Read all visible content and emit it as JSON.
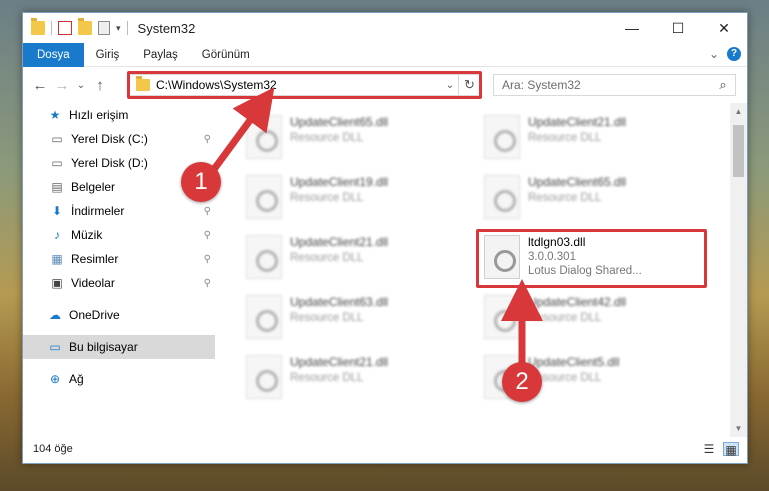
{
  "window": {
    "title": "System32",
    "minimize": "—",
    "maximize": "☐",
    "close": "✕"
  },
  "ribbon": {
    "tabs": [
      "Dosya",
      "Giriş",
      "Paylaş",
      "Görünüm"
    ],
    "help": "?",
    "expand": "⌄"
  },
  "nav": {
    "back": "←",
    "forward": "→",
    "recent": "⌄",
    "up": "↑"
  },
  "address": {
    "path": "C:\\Windows\\System32",
    "dropdown": "⌄",
    "refresh": "↻"
  },
  "search": {
    "placeholder": "Ara: System32",
    "icon": "⌕"
  },
  "sidebar": {
    "items": [
      {
        "label": "Hızlı erişim",
        "icon": "★",
        "pinned": false
      },
      {
        "label": "Yerel Disk (C:)",
        "icon": "▭",
        "pinned": true
      },
      {
        "label": "Yerel Disk (D:)",
        "icon": "▭",
        "pinned": false
      },
      {
        "label": "Belgeler",
        "icon": "▤",
        "pinned": true
      },
      {
        "label": "İndirmeler",
        "icon": "⬇",
        "pinned": true
      },
      {
        "label": "Müzik",
        "icon": "♪",
        "pinned": true
      },
      {
        "label": "Resimler",
        "icon": "▦",
        "pinned": true
      },
      {
        "label": "Videolar",
        "icon": "▣",
        "pinned": true
      },
      {
        "label": "OneDrive",
        "icon": "☁",
        "pinned": false
      },
      {
        "label": "Bu bilgisayar",
        "icon": "▭",
        "pinned": false
      },
      {
        "label": "Ağ",
        "icon": "⊕",
        "pinned": false
      }
    ],
    "pin_icon": "⚲"
  },
  "files": [
    {
      "name": "UpdateClient65.dll",
      "desc": "Resource DLL"
    },
    {
      "name": "UpdateClient21.dll",
      "desc": "Resource DLL"
    },
    {
      "name": "UpdateClient19.dll",
      "desc": "Resource DLL"
    },
    {
      "name": "UpdateClient65.dll",
      "desc": "Resource DLL"
    },
    {
      "name": "UpdateClient21.dll",
      "desc": "Resource DLL"
    },
    {
      "name": "ltdlgn03.dll",
      "desc": "3.0.0.301",
      "desc2": "Lotus Dialog Shared..."
    },
    {
      "name": "UpdateClient63.dll",
      "desc": "Resource DLL"
    },
    {
      "name": "UpdateClient42.dll",
      "desc": "Resource DLL"
    },
    {
      "name": "UpdateClient21.dll",
      "desc": "Resource DLL"
    },
    {
      "name": "UpdateClient5.dll",
      "desc": "Resource DLL"
    }
  ],
  "status": {
    "count": "104 öğe"
  },
  "annotations": {
    "step1": "1",
    "step2": "2"
  },
  "colors": {
    "accent": "#1979ca",
    "highlight": "#d9383a"
  }
}
